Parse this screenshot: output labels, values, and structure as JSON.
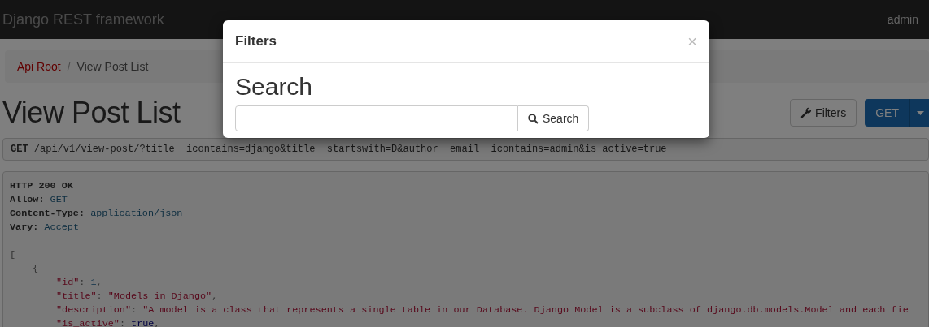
{
  "navbar": {
    "brand": "Django REST framework",
    "user": "admin"
  },
  "breadcrumbs": [
    {
      "label": "Api Root",
      "kind": "link",
      "separator": "/"
    },
    {
      "label": "View Post List",
      "kind": "current"
    }
  ],
  "page_title": "View Post List",
  "toolbar": {
    "filters_button": "Filters",
    "get_button": "GET"
  },
  "request": {
    "method": "GET",
    "url": "/api/v1/view-post/?title__icontains=django&title__startswith=D&author__email__icontains=admin&is_active=true"
  },
  "response": {
    "status": "HTTP 200 OK",
    "headers": [
      {
        "name": "Allow:",
        "value": "GET"
      },
      {
        "name": "Content-Type:",
        "value": "application/json"
      },
      {
        "name": "Vary:",
        "value": "Accept"
      }
    ],
    "body": {
      "open": "[",
      "items": [
        {
          "open": "{",
          "fields": [
            {
              "key": "\"id\"",
              "sep": ":",
              "value": "1",
              "kind": "number",
              "end": ","
            },
            {
              "key": "\"title\"",
              "sep": ":",
              "value": "\"Models in Django\"",
              "kind": "string",
              "end": ","
            },
            {
              "key": "\"description\"",
              "sep": ":",
              "value": "\"A model is a class that represents a single table in our Database. Django Model is a subclass of django.db.models.Model and each fie",
              "kind": "string"
            },
            {
              "key": "\"is_active\"",
              "sep": ":",
              "value": "true",
              "kind": "literal",
              "end": ","
            }
          ]
        }
      ]
    }
  },
  "modal": {
    "title": "Filters",
    "close": "×",
    "section_title": "Search",
    "search_button": "Search"
  }
}
